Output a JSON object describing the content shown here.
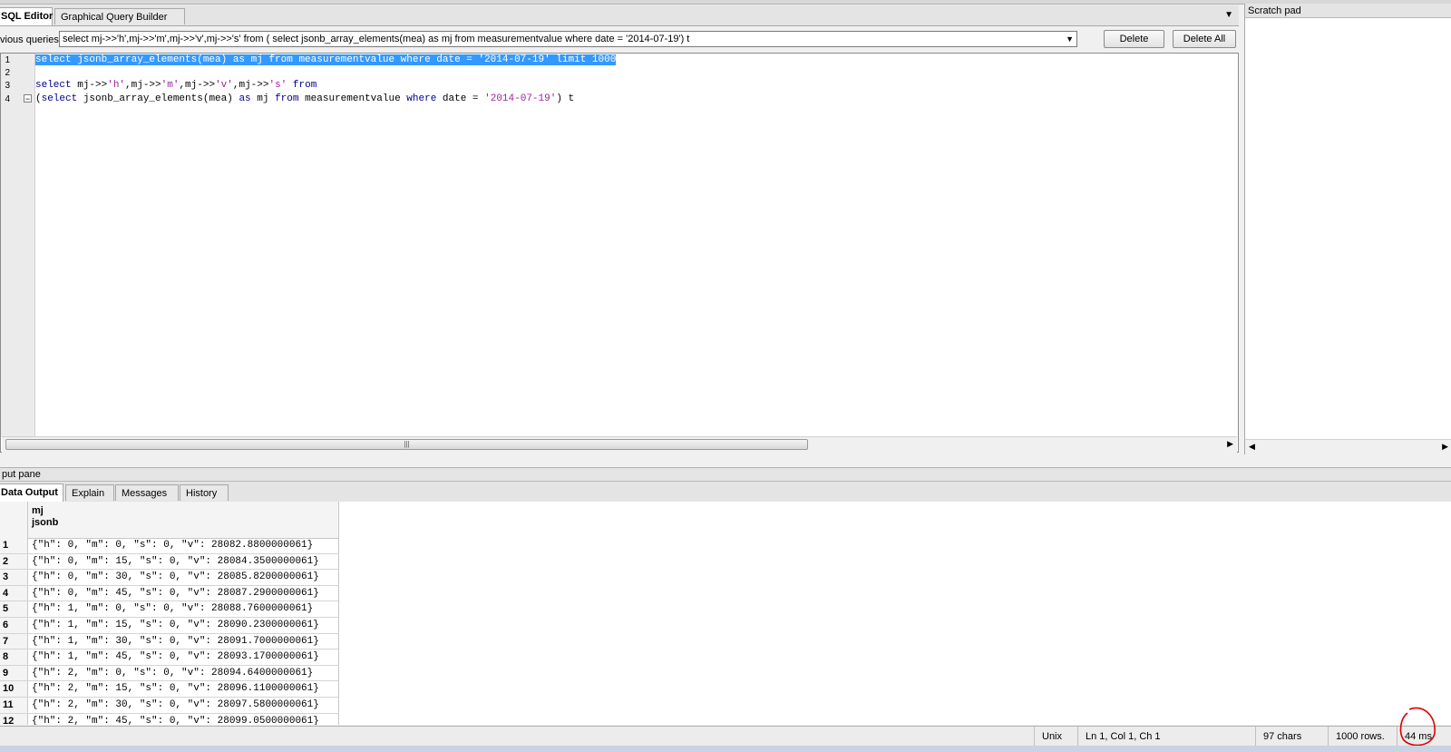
{
  "editor_tabs": [
    {
      "label": "SQL Editor",
      "active": true
    },
    {
      "label": "Graphical Query Builder",
      "active": false
    }
  ],
  "previous_queries": {
    "label": "vious queries",
    "selected": "select mj->>'h',mj->>'m',mj->>'v',mj->>'s' from ( select jsonb_array_elements(mea) as mj from measurementvalue where date = '2014-07-19') t",
    "delete_label": "Delete",
    "delete_all_label": "Delete All"
  },
  "editor": {
    "line_numbers": [
      "1",
      "2",
      "3",
      "4"
    ],
    "lines": [
      "select jsonb_array_elements(mea) as mj from measurementvalue where date = '2014-07-19' limit 1000",
      "",
      "select mj->>'h',mj->>'m',mj->>'v',mj->>'s' from",
      "(select jsonb_array_elements(mea) as mj from measurementvalue where date = '2014-07-19') t"
    ],
    "selected_line": 1
  },
  "scratch_pad": {
    "title": "Scratch pad"
  },
  "output_pane": {
    "title": "put pane",
    "tabs": [
      {
        "label": "Data Output",
        "active": true
      },
      {
        "label": "Explain",
        "active": false
      },
      {
        "label": "Messages",
        "active": false
      },
      {
        "label": "History",
        "active": false
      }
    ],
    "column": {
      "name": "mj",
      "type": "jsonb"
    },
    "rows": [
      {
        "n": "1",
        "v": "{\"h\": 0, \"m\": 0, \"s\": 0, \"v\": 28082.8800000061}"
      },
      {
        "n": "2",
        "v": "{\"h\": 0, \"m\": 15, \"s\": 0, \"v\": 28084.3500000061}"
      },
      {
        "n": "3",
        "v": "{\"h\": 0, \"m\": 30, \"s\": 0, \"v\": 28085.8200000061}"
      },
      {
        "n": "4",
        "v": "{\"h\": 0, \"m\": 45, \"s\": 0, \"v\": 28087.2900000061}"
      },
      {
        "n": "5",
        "v": "{\"h\": 1, \"m\": 0, \"s\": 0, \"v\": 28088.7600000061}"
      },
      {
        "n": "6",
        "v": "{\"h\": 1, \"m\": 15, \"s\": 0, \"v\": 28090.2300000061}"
      },
      {
        "n": "7",
        "v": "{\"h\": 1, \"m\": 30, \"s\": 0, \"v\": 28091.7000000061}"
      },
      {
        "n": "8",
        "v": "{\"h\": 1, \"m\": 45, \"s\": 0, \"v\": 28093.1700000061}"
      },
      {
        "n": "9",
        "v": "{\"h\": 2, \"m\": 0, \"s\": 0, \"v\": 28094.6400000061}"
      },
      {
        "n": "10",
        "v": "{\"h\": 2, \"m\": 15, \"s\": 0, \"v\": 28096.1100000061}"
      },
      {
        "n": "11",
        "v": "{\"h\": 2, \"m\": 30, \"s\": 0, \"v\": 28097.5800000061}"
      },
      {
        "n": "12",
        "v": "{\"h\": 2, \"m\": 45, \"s\": 0, \"v\": 28099.0500000061}"
      }
    ]
  },
  "statusbar": {
    "line_ending": "Unix",
    "cursor": "Ln 1, Col 1, Ch 1",
    "chars": "97 chars",
    "rows": "1000 rows.",
    "time": "44 ms"
  },
  "colors": {
    "selection": "#3399ff",
    "keyword": "#00008b",
    "string": "#a020a0",
    "annotation": "#e00000"
  }
}
